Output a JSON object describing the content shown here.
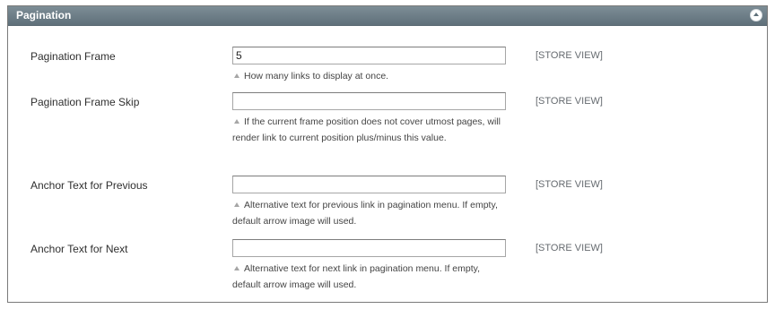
{
  "panel": {
    "title": "Pagination",
    "collapse_icon": "chevron-up-icon"
  },
  "fields": [
    {
      "label": "Pagination Frame",
      "value": "5",
      "scope": "[STORE VIEW]",
      "note": "How many links to display at once."
    },
    {
      "label": "Pagination Frame Skip",
      "value": "",
      "scope": "[STORE VIEW]",
      "note": "If the current frame position does not cover utmost pages, will render link to current position plus/minus this value."
    },
    {
      "label": "Anchor Text for Previous",
      "value": "",
      "scope": "[STORE VIEW]",
      "note": "Alternative text for previous link in pagination menu. If empty, default arrow image will used."
    },
    {
      "label": "Anchor Text for Next",
      "value": "",
      "scope": "[STORE VIEW]",
      "note": "Alternative text for next link in pagination menu. If empty, default arrow image will used."
    }
  ]
}
